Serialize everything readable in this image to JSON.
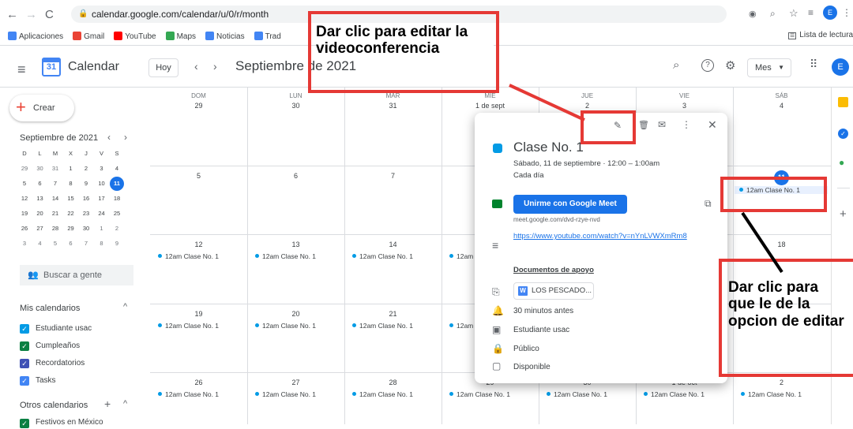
{
  "browser": {
    "url": "calendar.google.com/calendar/u/0/r/month",
    "profile_initial": "E",
    "reading_list": "Lista de lectura",
    "bookmarks": [
      {
        "label": "Aplicaciones",
        "color": "#4285f4"
      },
      {
        "label": "Gmail",
        "color": "#ea4335"
      },
      {
        "label": "YouTube",
        "color": "#ff0000"
      },
      {
        "label": "Maps",
        "color": "#34a853"
      },
      {
        "label": "Noticias",
        "color": "#4285f4"
      },
      {
        "label": "Trad",
        "color": "#4285f4"
      }
    ]
  },
  "app": {
    "title": "Calendar",
    "logo_day": "31",
    "today_button": "Hoy",
    "month_title": "Septiembre de 2021",
    "view_select": "Mes",
    "user_initial": "E"
  },
  "sidebar": {
    "create": "Crear",
    "mini_title": "Septiembre de 2021",
    "weekday_letters": [
      "D",
      "L",
      "M",
      "X",
      "J",
      "V",
      "S"
    ],
    "weeks": [
      [
        "29",
        "30",
        "31",
        "1",
        "2",
        "3",
        "4"
      ],
      [
        "5",
        "6",
        "7",
        "8",
        "9",
        "10",
        "11"
      ],
      [
        "12",
        "13",
        "14",
        "15",
        "16",
        "17",
        "18"
      ],
      [
        "19",
        "20",
        "21",
        "22",
        "23",
        "24",
        "25"
      ],
      [
        "26",
        "27",
        "28",
        "29",
        "30",
        "1",
        "2"
      ],
      [
        "3",
        "4",
        "5",
        "6",
        "7",
        "8",
        "9"
      ]
    ],
    "search_people": "Buscar a gente",
    "my_calendars": "Mis calendarios",
    "calendars": [
      {
        "label": "Estudiante usac",
        "color": "#039be5"
      },
      {
        "label": "Cumpleaños",
        "color": "#0b8043"
      },
      {
        "label": "Recordatorios",
        "color": "#3f51b5"
      },
      {
        "label": "Tasks",
        "color": "#4285f4"
      }
    ],
    "other_calendars": "Otros calendarios",
    "other_items": [
      {
        "label": "Festivos en México",
        "color": "#0b8043"
      }
    ]
  },
  "grid": {
    "days": [
      "DOM",
      "LUN",
      "MAR",
      "MIÉ",
      "JUE",
      "VIE",
      "SÁB"
    ],
    "week1": [
      "29",
      "30",
      "31",
      "1 de sept",
      "2",
      "3",
      "4"
    ],
    "rows": [
      {
        "nums": [
          "5",
          "6",
          "7",
          "",
          "",
          "",
          "11"
        ]
      },
      {
        "nums": [
          "12",
          "13",
          "14",
          "",
          "",
          "",
          "18"
        ]
      },
      {
        "nums": [
          "19",
          "20",
          "21",
          "",
          "",
          "",
          ""
        ]
      },
      {
        "nums": [
          "26",
          "27",
          "28",
          "29",
          "30",
          "1 de oct",
          "2"
        ]
      }
    ],
    "event_label": "12am Clase No. 1"
  },
  "popup": {
    "title": "Clase No. 1",
    "datetime": "Sábado, 11 de septiembre  ·  12:00 – 1:00am",
    "recurrence": "Cada día",
    "meet_button": "Unirme con Google Meet",
    "meet_link": "meet.google.com/dvd-rzye-nvd",
    "description_link": "https://www.youtube.com/watch?v=nYnLVWXmRm8",
    "docs_heading": "Documentos de apoyo",
    "attachment": "LOS PESCADO...",
    "reminder": "30 minutos antes",
    "calendar": "Estudiante usac",
    "visibility": "Público",
    "availability": "Disponible",
    "color": "#039be5"
  },
  "annotations": {
    "top": "Dar clic para editar la videoconferencia",
    "right": "Dar clic para que le de la opcion de editar",
    "color": "#e53935"
  }
}
